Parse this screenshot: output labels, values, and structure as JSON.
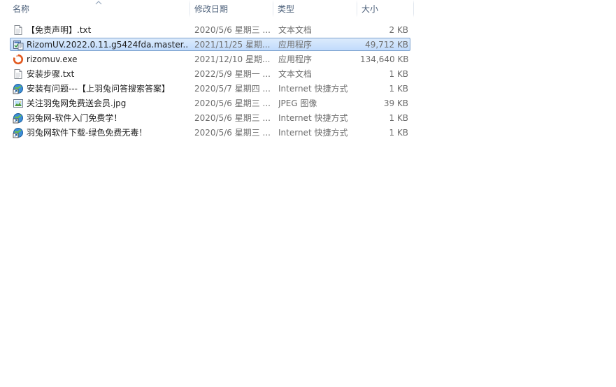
{
  "columns": {
    "name": "名称",
    "date": "修改日期",
    "type": "类型",
    "size": "大小"
  },
  "files": [
    {
      "name": "【免责声明】.txt",
      "date": "2020/5/6 星期三 ...",
      "type": "文本文档",
      "size": "2 KB",
      "icon": "text-file-icon"
    },
    {
      "name": "RizomUV.2022.0.11.g5424fda.master....",
      "date": "2021/11/25 星期...",
      "type": "应用程序",
      "size": "49,712 KB",
      "icon": "installer-icon",
      "selected": true
    },
    {
      "name": "rizomuv.exe",
      "date": "2021/12/10 星期...",
      "type": "应用程序",
      "size": "134,640 KB",
      "icon": "rizomuv-app-icon"
    },
    {
      "name": "安装步骤.txt",
      "date": "2022/5/9 星期一 ...",
      "type": "文本文档",
      "size": "1 KB",
      "icon": "text-file-icon"
    },
    {
      "name": "安装有问题---【上羽兔问答搜索答案】",
      "date": "2020/5/7 星期四 ...",
      "type": "Internet 快捷方式",
      "size": "1 KB",
      "icon": "internet-shortcut-icon"
    },
    {
      "name": "关注羽兔网免费送会员.jpg",
      "date": "2020/5/6 星期三 ...",
      "type": "JPEG 图像",
      "size": "39 KB",
      "icon": "image-file-icon"
    },
    {
      "name": "羽兔网-软件入门免费学！",
      "date": "2020/5/6 星期三 ...",
      "type": "Internet 快捷方式",
      "size": "1 KB",
      "icon": "internet-shortcut-icon"
    },
    {
      "name": "羽兔网软件下载-绿色免费无毒！",
      "date": "2020/5/6 星期三 ...",
      "type": "Internet 快捷方式",
      "size": "1 KB",
      "icon": "internet-shortcut-icon"
    }
  ]
}
